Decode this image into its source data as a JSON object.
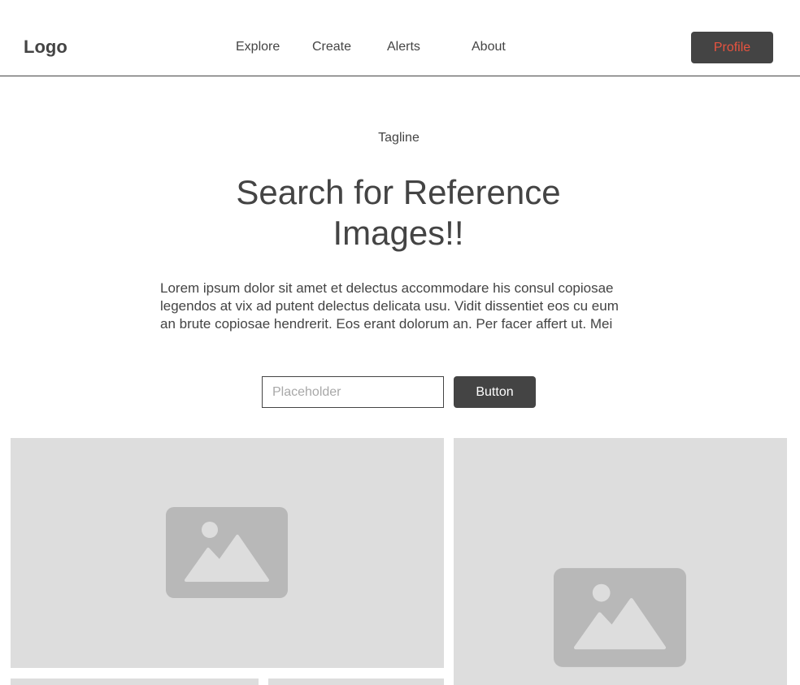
{
  "header": {
    "logo": "Logo",
    "nav": {
      "explore": "Explore",
      "create": "Create",
      "alerts": "Alerts",
      "about": "About"
    },
    "profile_label": "Profile"
  },
  "hero": {
    "tagline": "Tagline",
    "title": "Search for Reference Images!!",
    "body": "Lorem ipsum dolor sit amet et delectus accommodare his consul copiosae legendos at vix ad putent delectus delicata usu. Vidit dissentiet eos cu eum an brute copiosae hendrerit. Eos erant dolorum an. Per facer affert ut. Mei"
  },
  "search": {
    "placeholder": "Placeholder",
    "value": "",
    "button_label": "Button"
  },
  "gallery": {
    "icon": "image-placeholder-icon"
  },
  "colors": {
    "primary": "#444444",
    "accent": "#e8533f",
    "tile_background": "#dddddd",
    "icon": "#b8b8b8"
  }
}
